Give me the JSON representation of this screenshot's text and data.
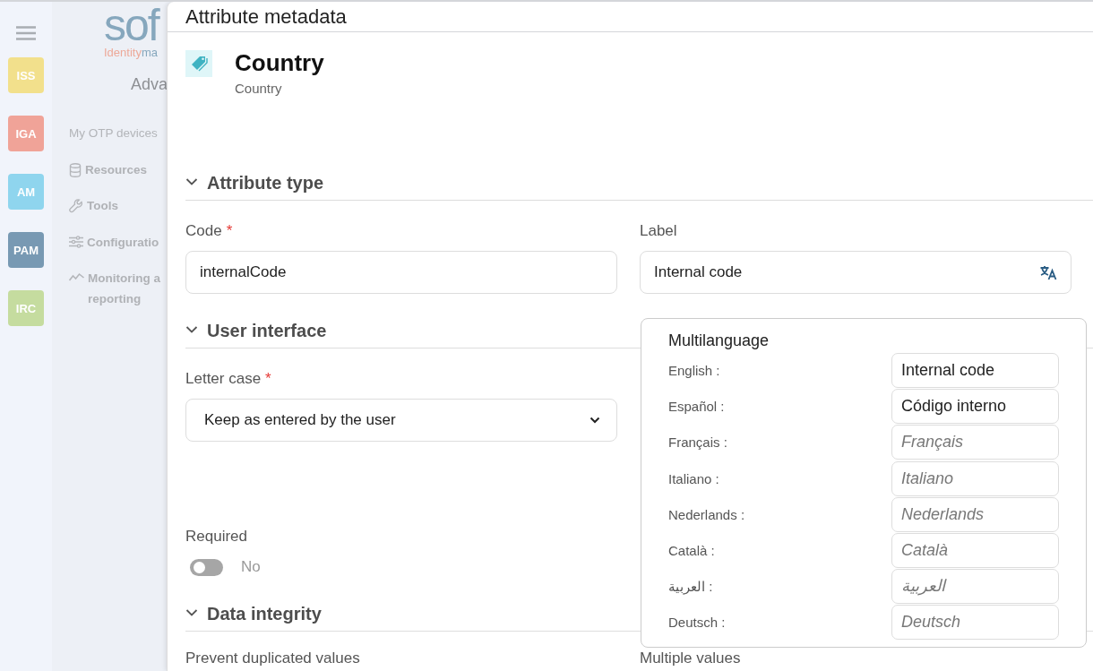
{
  "app_rail": [
    {
      "label": "ISS",
      "color": "#f2e08c"
    },
    {
      "label": "IGA",
      "color": "#f0a398"
    },
    {
      "label": "AM",
      "color": "#8fd5ee"
    },
    {
      "label": "PAM",
      "color": "#7899b3"
    },
    {
      "label": "IRC",
      "color": "#c5dc9f"
    }
  ],
  "brand": {
    "logo": "sof",
    "tagline_first": "Identity",
    "tagline_second": "ma"
  },
  "nav": {
    "heading": "Adva",
    "items": [
      {
        "label": "My OTP devices"
      },
      {
        "label": "Resources"
      },
      {
        "label": "Tools"
      },
      {
        "label": "Configuratio"
      },
      {
        "label": "Monitoring a\nreporting"
      }
    ]
  },
  "drawer": {
    "title": "Attribute metadata",
    "header": {
      "title": "Country",
      "subtitle": "Country"
    },
    "sections": [
      {
        "title": "Attribute type",
        "expanded": true,
        "fields": [
          {
            "kind": "text",
            "label": "Code",
            "required_mark": "*",
            "value": "internalCode"
          },
          {
            "kind": "translatable",
            "label": "Label",
            "value": "Internal code"
          }
        ]
      },
      {
        "title": "User interface",
        "expanded": true,
        "fields": [
          {
            "kind": "select",
            "label": "Letter case",
            "required_mark": "*",
            "value": "Keep as entered by the user"
          },
          {
            "kind": "toggle",
            "label": "Required",
            "on": false,
            "text": "No"
          }
        ]
      },
      {
        "title": "Data integrity",
        "expanded": true,
        "fields": [
          {
            "kind": "label",
            "label": "Prevent duplicated values"
          },
          {
            "kind": "label",
            "label": "Multiple values"
          }
        ]
      }
    ]
  },
  "multilanguage": {
    "title": "Multilanguage",
    "rows": [
      {
        "language": "English :",
        "value": "Internal code"
      },
      {
        "language": "Español :",
        "value": "Código interno"
      },
      {
        "language": "Français :",
        "placeholder": "Français"
      },
      {
        "language": "Italiano :",
        "placeholder": "Italiano"
      },
      {
        "language": "Nederlands :",
        "placeholder": "Nederlands"
      },
      {
        "language": "Català :",
        "placeholder": "Català"
      },
      {
        "language": "العربية :",
        "placeholder": "العربية"
      },
      {
        "language": "Deutsch :",
        "placeholder": "Deutsch"
      }
    ]
  }
}
